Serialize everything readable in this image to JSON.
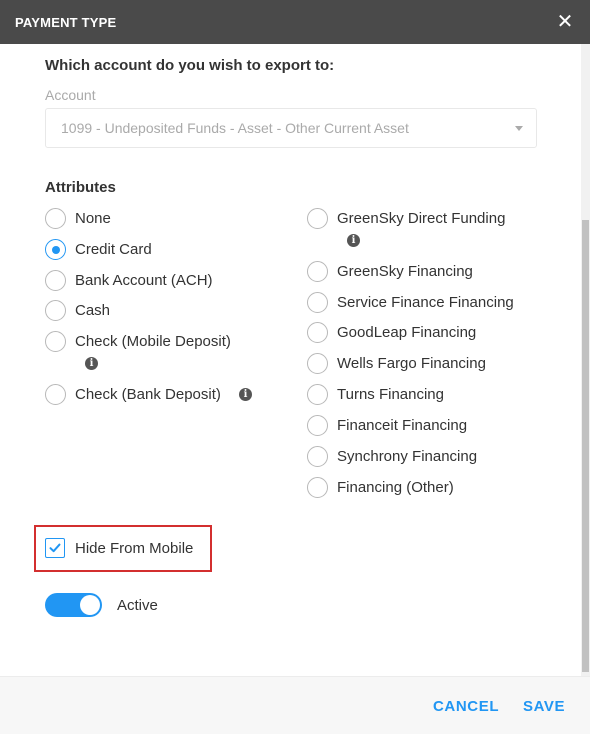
{
  "dialog": {
    "title": "PAYMENT TYPE",
    "close_icon": "close-icon"
  },
  "form": {
    "question": "Which account do you wish to export to:",
    "account_label": "Account",
    "account_value": "1099 - Undeposited Funds - Asset - Other Current Asset",
    "attributes_label": "Attributes"
  },
  "attributes": {
    "selected": "Credit Card",
    "left": [
      {
        "label": "None"
      },
      {
        "label": "Credit Card"
      },
      {
        "label": "Bank Account (ACH)"
      },
      {
        "label": "Cash"
      },
      {
        "label": "Check (Mobile Deposit)"
      },
      {
        "label": "Check (Bank Deposit)"
      }
    ],
    "right": [
      {
        "label": "GreenSky Direct Funding"
      },
      {
        "label": "GreenSky Financing"
      },
      {
        "label": "Service Finance Financing"
      },
      {
        "label": "GoodLeap Financing"
      },
      {
        "label": "Wells Fargo Financing"
      },
      {
        "label": "Turns Financing"
      },
      {
        "label": "Financeit Financing"
      },
      {
        "label": "Synchrony Financing"
      },
      {
        "label": "Financing (Other)"
      }
    ],
    "info_glyph": "i"
  },
  "options": {
    "hide_from_mobile_label": "Hide From Mobile",
    "hide_from_mobile_checked": true,
    "active_label": "Active",
    "active_on": true
  },
  "footer": {
    "cancel_label": "CANCEL",
    "save_label": "SAVE"
  },
  "colors": {
    "accent": "#2196f3",
    "header_bg": "#4a4a4a",
    "highlight_border": "#d32f2f"
  }
}
